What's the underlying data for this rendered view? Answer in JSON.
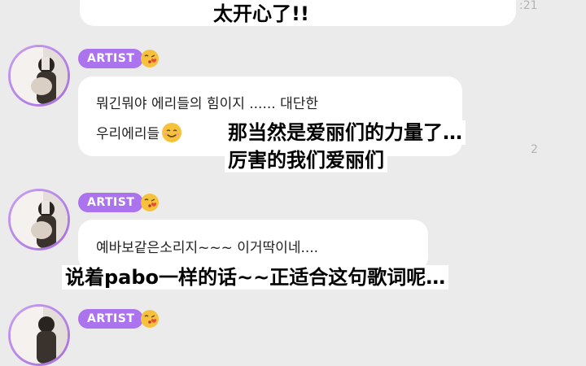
{
  "messages": [
    {
      "timestamp": ":21",
      "subtitle": "太开心了!!"
    },
    {
      "badge": "ARTIST",
      "text_line1": "뭐긴뭐야 에리들의 힘이지 ...... 대단한",
      "text_line2": "우리에리들",
      "timestamp": "2",
      "subtitle_line1": "那当然是爱丽们的力量了…",
      "subtitle_line2": "厉害的我们爱丽们"
    },
    {
      "badge": "ARTIST",
      "text_line1": "예바보같은소리지~~~ 이거딱이네....",
      "subtitle": "说着pabo一样的话~~正适合这句歌词呢…"
    },
    {
      "badge": "ARTIST"
    }
  ],
  "icons": {
    "badge_emoji": "kissing-face-emoji",
    "inline_emoji": "smiling-face-emoji"
  },
  "colors": {
    "background": "#ebebeb",
    "bubble": "#ffffff",
    "badge": "#ab74ee",
    "avatar_ring": "#b98be8"
  }
}
